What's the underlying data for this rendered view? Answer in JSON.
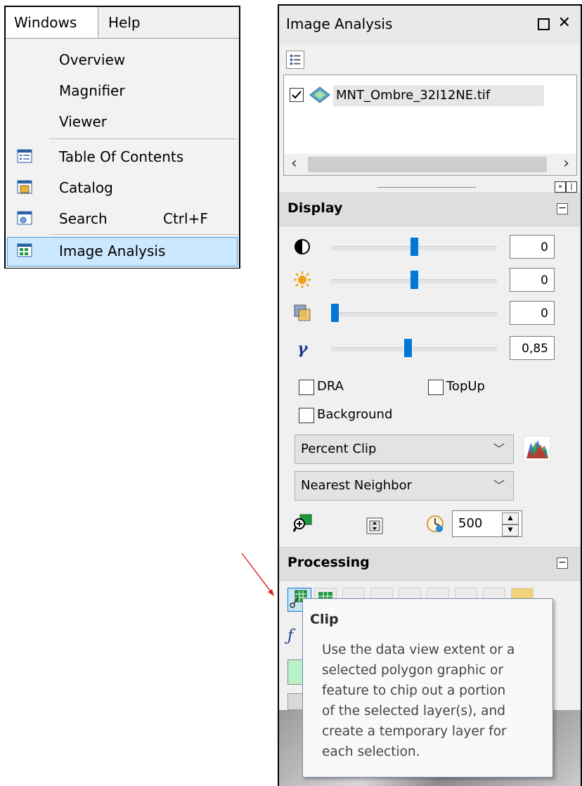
{
  "menu": {
    "bar": [
      "Windows",
      "Help"
    ],
    "items": [
      {
        "label": "Overview",
        "icon": "none"
      },
      {
        "label": "Magnifier",
        "icon": "none"
      },
      {
        "label": "Viewer",
        "icon": "none"
      },
      {
        "label": "Table Of Contents",
        "icon": "table-of-contents-icon"
      },
      {
        "label": "Catalog",
        "icon": "catalog-icon"
      },
      {
        "label": "Search",
        "shortcut": "Ctrl+F",
        "icon": "search-window-icon"
      },
      {
        "label": "Image Analysis",
        "icon": "image-analysis-icon",
        "highlighted": true
      }
    ]
  },
  "panel": {
    "title": "Image Analysis",
    "layer": {
      "name": "MNT_Ombre_32I12NE.tif",
      "checked": true
    },
    "display": {
      "title": "Display",
      "sliders": [
        {
          "name": "contrast",
          "value": "0",
          "level": 0.5
        },
        {
          "name": "brightness",
          "value": "0",
          "level": 0.5
        },
        {
          "name": "transparency",
          "value": "0",
          "level": 0.0
        },
        {
          "name": "gamma",
          "value": "0,85",
          "level": 0.46
        }
      ],
      "checkboxes": {
        "dra": "DRA",
        "topup": "TopUp",
        "background": "Background"
      },
      "stretch": "Percent Clip",
      "resampling": "Nearest Neighbor",
      "refresh_value": "500"
    },
    "processing": {
      "title": "Processing"
    }
  },
  "tooltip": {
    "title": "Clip",
    "body": "Use the data view extent or a\nselected polygon graphic or\nfeature to chip out a portion\nof the selected layer(s), and\ncreate a temporary layer for\neach selection."
  },
  "colors": {
    "accent": "#0078d7",
    "highlight": "#cce8ff",
    "arrow": "#e02020"
  }
}
